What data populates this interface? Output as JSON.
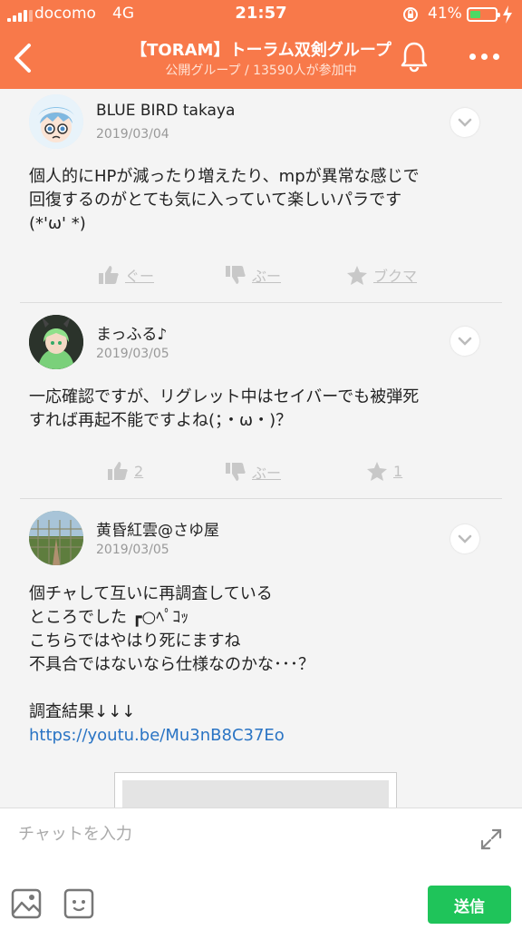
{
  "status_bar": {
    "carrier": "docomo",
    "network": "4G",
    "time": "21:57",
    "battery_percent": "41%",
    "battery_level": 0.41
  },
  "header": {
    "title": "【TORAM】トーラム双剣グループ",
    "subtitle": "公開グループ / 13590人が参加中",
    "background_color": "#f8794a"
  },
  "posts": [
    {
      "user": "BLUE BIRD takaya",
      "date": "2019/03/04",
      "body": "個人的にHPが減ったり増えたり、mpが異常な感じで\n回復するのがとても気に入っていて楽しいパラです\n(*'ω' *)",
      "good_label": "ぐー",
      "boo_label": "ぶー",
      "bookmark_label": "ブクマ"
    },
    {
      "user": "まっふる♪",
      "date": "2019/03/05",
      "body": "一応確認ですが、リグレット中はセイバーでも被弾死\nすれば再起不能ですよね(；・ω・)？",
      "good_label": "2",
      "boo_label": "ぶー",
      "bookmark_label": "1"
    },
    {
      "user": "黄昏紅雲@さゆ屋",
      "date": "2019/03/05",
      "body": "個チャして互いに再調査している\nところでした ┏○ﾍﾟｺｯ\nこちらではやはり死にますね\n不具合ではないなら仕様なのかな･･･？\n\n調査結果↓↓↓",
      "link": "https://youtu.be/Mu3nB8C37Eo"
    }
  ],
  "composer": {
    "placeholder": "チャットを入力",
    "send_label": "送信",
    "send_color": "#1fc45a"
  },
  "icons": [
    "back-icon",
    "bell-icon",
    "more-icon",
    "chevron-down-icon",
    "thumbs-up-icon",
    "thumbs-down-icon",
    "star-icon",
    "expand-icon",
    "image-icon",
    "sticker-icon"
  ]
}
